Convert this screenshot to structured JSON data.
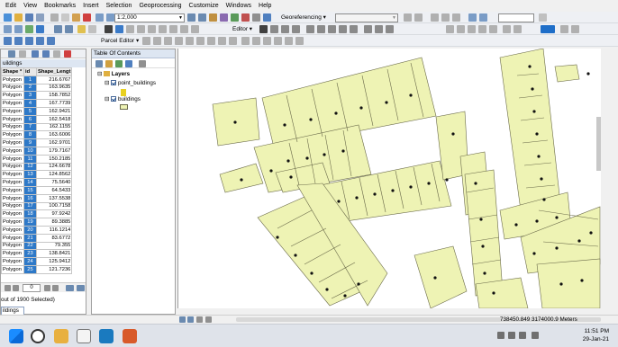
{
  "menu": {
    "items": [
      "Edit",
      "View",
      "Bookmarks",
      "Insert",
      "Selection",
      "Geoprocessing",
      "Customize",
      "Windows",
      "Help"
    ]
  },
  "toolbar": {
    "scale_value": "1:2,000",
    "georef_label": "Georeferencing",
    "editor_label": "Editor",
    "parcel_editor_label": "Parcel Editor"
  },
  "table_panel": {
    "tab_label": "uildings",
    "columns": [
      "Shape *",
      "id",
      "Shape_Lengt"
    ],
    "rows": [
      [
        "Polygon",
        "1",
        "216.6767"
      ],
      [
        "Polygon",
        "2",
        "163.9635"
      ],
      [
        "Polygon",
        "3",
        "158.7852"
      ],
      [
        "Polygon",
        "4",
        "167.7739"
      ],
      [
        "Polygon",
        "5",
        "162.9421"
      ],
      [
        "Polygon",
        "6",
        "162.5418"
      ],
      [
        "Polygon",
        "7",
        "162.1155"
      ],
      [
        "Polygon",
        "8",
        "163.6006"
      ],
      [
        "Polygon",
        "9",
        "162.9701"
      ],
      [
        "Polygon",
        "10",
        "179.7167"
      ],
      [
        "Polygon",
        "11",
        "150.2185"
      ],
      [
        "Polygon",
        "12",
        "124.6678"
      ],
      [
        "Polygon",
        "13",
        "124.8562"
      ],
      [
        "Polygon",
        "14",
        "75.5640"
      ],
      [
        "Polygon",
        "15",
        "64.5433"
      ],
      [
        "Polygon",
        "16",
        "137.5538"
      ],
      [
        "Polygon",
        "17",
        "100.7158"
      ],
      [
        "Polygon",
        "18",
        "97.9242"
      ],
      [
        "Polygon",
        "19",
        "89.3885"
      ],
      [
        "Polygon",
        "20",
        "116.1214"
      ],
      [
        "Polygon",
        "21",
        "83.6772"
      ],
      [
        "Polygon",
        "22",
        "79.355"
      ],
      [
        "Polygon",
        "23",
        "138.8421"
      ],
      [
        "Polygon",
        "24",
        "125.9412"
      ],
      [
        "Polygon",
        "25",
        "121.7236"
      ]
    ],
    "nav_value": "0",
    "selection_text": "out of 1900 Selected)",
    "bottom_tab": "ildings"
  },
  "toc": {
    "title": "Table Of Contents",
    "root": "Layers",
    "layers": [
      "point_buildings",
      "buildings"
    ]
  },
  "status": {
    "coords": "738450.849  3174000.9 Meters"
  },
  "clock": {
    "time": "11:51 PM",
    "date": "29-Jan-21"
  },
  "colors": {
    "building_fill": "#eef3b4",
    "building_stroke": "#6a6a4a",
    "selected_row": "#2e79c8"
  },
  "icons": [
    "windows-start-icon",
    "search-icon",
    "edge-browser-icon",
    "mail-icon",
    "arcgis-icon",
    "powerpoint-icon"
  ]
}
